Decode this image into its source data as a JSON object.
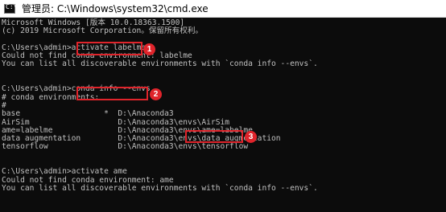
{
  "window": {
    "title": "管理员: C:\\Windows\\system32\\cmd.exe",
    "icon": "cmd-console-icon",
    "icon_glyph": "C:\\"
  },
  "console": {
    "lines": [
      "Microsoft Windows [版本 10.0.18363.1500]",
      "(c) 2019 Microsoft Corporation。保留所有权利。",
      "",
      "C:\\Users\\admin>activate labelme",
      "Could not find conda environment: labelme",
      "You can list all discoverable environments with `conda info --envs`.",
      "",
      "",
      "C:\\Users\\admin>conda info --envs",
      "# conda environments:",
      "#",
      "base                  *  D:\\Anaconda3",
      "AirSim                   D:\\Anaconda3\\envs\\AirSim",
      "ame=labelme              D:\\Anaconda3\\envs\\ame=labelme",
      "data augmentation        D:\\Anaconda3\\envs\\data augmentation",
      "tensorflow               D:\\Anaconda3\\envs\\tensorflow",
      "",
      "",
      "C:\\Users\\admin>activate ame",
      "Could not find conda environment: ame",
      "You can list all discoverable environments with `conda info --envs`."
    ]
  },
  "annotations": {
    "callout_1": "1",
    "callout_2": "2",
    "callout_3": "3",
    "color": "#e0242b"
  }
}
